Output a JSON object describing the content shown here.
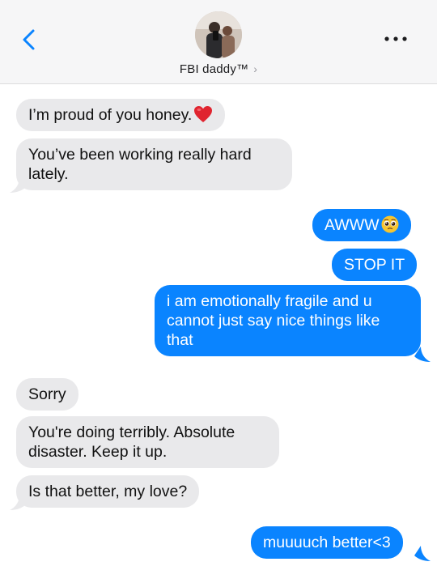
{
  "header": {
    "contact_name": "FBI daddy™",
    "chevron": "›",
    "back_icon": "chevron-left-icon",
    "more_icon": "ellipsis-icon",
    "accent_color": "#0a84ff"
  },
  "messages": [
    {
      "direction": "incoming",
      "text": "I’m proud of you honey.",
      "emoji": "red-heart-emoji"
    },
    {
      "direction": "incoming",
      "text": "You’ve been working really hard lately."
    },
    {
      "direction": "outgoing",
      "text": "AWWW",
      "emoji": "pleading-face-emoji"
    },
    {
      "direction": "outgoing",
      "text": "STOP IT"
    },
    {
      "direction": "outgoing",
      "text": "i am emotionally fragile and u cannot just say nice things like that"
    },
    {
      "direction": "incoming",
      "text": "Sorry"
    },
    {
      "direction": "incoming",
      "text": "You're doing terribly. Absolute disaster. Keep it up."
    },
    {
      "direction": "incoming",
      "text": "Is that better, my love?"
    },
    {
      "direction": "outgoing",
      "text": "muuuuch better<3"
    }
  ],
  "colors": {
    "incoming_bubble": "#e9e9eb",
    "outgoing_bubble": "#0a84ff",
    "header_background": "#f6f6f7"
  }
}
